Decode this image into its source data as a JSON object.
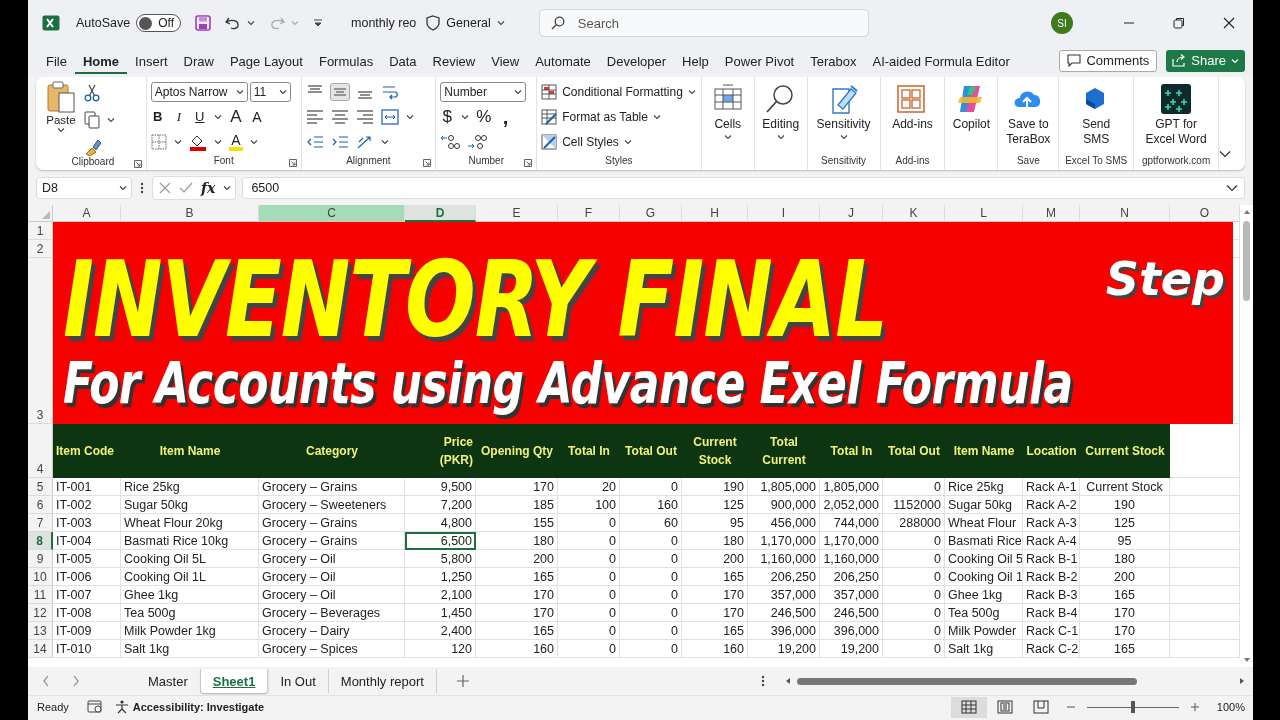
{
  "titlebar": {
    "autosave_label": "AutoSave",
    "autosave": {
      "label": "Off",
      "on": false
    },
    "file_name": "monthly reo",
    "sensitivity_label": "General",
    "search": {
      "placeholder": "Search"
    },
    "avatar": "SI"
  },
  "menu_tabs": [
    {
      "label": "File",
      "selected": false
    },
    {
      "label": "Home",
      "selected": true
    },
    {
      "label": "Insert",
      "selected": false
    },
    {
      "label": "Draw",
      "selected": false
    },
    {
      "label": "Page Layout",
      "selected": false
    },
    {
      "label": "Formulas",
      "selected": false
    },
    {
      "label": "Data",
      "selected": false
    },
    {
      "label": "Review",
      "selected": false
    },
    {
      "label": "View",
      "selected": false
    },
    {
      "label": "Automate",
      "selected": false
    },
    {
      "label": "Developer",
      "selected": false
    },
    {
      "label": "Help",
      "selected": false
    },
    {
      "label": "Power Pivot",
      "selected": false
    },
    {
      "label": "Terabox",
      "selected": false
    },
    {
      "label": "AI-aided Formula Editor",
      "selected": false
    }
  ],
  "actions": {
    "comments": "Comments",
    "share": "Share"
  },
  "ribbon": {
    "clipboard": {
      "paste": "Paste",
      "label": "Clipboard"
    },
    "font": {
      "name": "Aptos Narrow",
      "size": "11",
      "styles": [
        "B",
        "I",
        "U"
      ],
      "size_buttons": [
        "A",
        "A"
      ],
      "color_button": "A",
      "label": "Font"
    },
    "alignment": {
      "label": "Alignment"
    },
    "number": {
      "format": "Number",
      "symbols": [
        "$",
        "%",
        ","
      ],
      "label": "Number"
    },
    "styles": {
      "items": [
        "Conditional Formatting",
        "Format as Table",
        "Cell Styles"
      ],
      "label": "Styles"
    },
    "groups": [
      {
        "buttons": [
          {
            "kind": "cells",
            "label": "Cells",
            "dropdown": true
          }
        ]
      },
      {
        "buttons": [
          {
            "kind": "editing",
            "label": "Editing",
            "dropdown": true
          }
        ]
      },
      {
        "buttons": [
          {
            "kind": "sensitivity",
            "label": "Sensitivity",
            "dropdown": true
          }
        ],
        "label": "Sensitivity"
      },
      {
        "buttons": [
          {
            "kind": "addins",
            "label": "Add-ins",
            "dropdown": false
          }
        ],
        "label": "Add-ins"
      },
      {
        "buttons": [
          {
            "kind": "copilot",
            "label": "Copilot",
            "dropdown": false
          }
        ]
      },
      {
        "buttons": [
          {
            "kind": "terabox",
            "label": "Save to\nTeraBox",
            "dropdown": false
          }
        ],
        "label": "Save"
      },
      {
        "buttons": [
          {
            "kind": "sms",
            "label": "Send\nSMS",
            "dropdown": false
          }
        ],
        "label": "Excel To SMS"
      },
      {
        "buttons": [
          {
            "kind": "gpt",
            "label": "GPT for\nExcel Word",
            "dropdown": false
          }
        ],
        "label": "gptforwork.com"
      }
    ]
  },
  "formula_bar": {
    "cell_ref": "D8",
    "fx": "fx",
    "value": "6500"
  },
  "columns": [
    {
      "letter": "A",
      "selected": false,
      "highlighted": false
    },
    {
      "letter": "B",
      "selected": false,
      "highlighted": false
    },
    {
      "letter": "C",
      "selected": false,
      "highlighted": true
    },
    {
      "letter": "D",
      "selected": true,
      "highlighted": false
    },
    {
      "letter": "E",
      "selected": false,
      "highlighted": false
    },
    {
      "letter": "F",
      "selected": false,
      "highlighted": false
    },
    {
      "letter": "G",
      "selected": false,
      "highlighted": false
    },
    {
      "letter": "H",
      "selected": false,
      "highlighted": false
    },
    {
      "letter": "I",
      "selected": false,
      "highlighted": false
    },
    {
      "letter": "J",
      "selected": false,
      "highlighted": false
    },
    {
      "letter": "K",
      "selected": false,
      "highlighted": false
    },
    {
      "letter": "L",
      "selected": false,
      "highlighted": false
    },
    {
      "letter": "M",
      "selected": false,
      "highlighted": false
    },
    {
      "letter": "N",
      "selected": false,
      "highlighted": false
    },
    {
      "letter": "O",
      "selected": false,
      "highlighted": false
    }
  ],
  "rows": [
    {
      "number": "1",
      "selected": false
    },
    {
      "number": "2",
      "selected": false
    },
    {
      "number": "3",
      "selected": false
    },
    {
      "number": "4",
      "selected": false
    },
    {
      "number": "5",
      "selected": false
    },
    {
      "number": "6",
      "selected": false
    },
    {
      "number": "7",
      "selected": false
    },
    {
      "number": "8",
      "selected": true
    },
    {
      "number": "9",
      "selected": false
    },
    {
      "number": "10",
      "selected": false
    },
    {
      "number": "11",
      "selected": false
    },
    {
      "number": "12",
      "selected": false
    },
    {
      "number": "13",
      "selected": false
    },
    {
      "number": "14",
      "selected": false
    }
  ],
  "banner": {
    "title": "INVENTORY FINAL",
    "tag": "Step",
    "subtitle": "For Accounts using Advance Exel Formula"
  },
  "table": {
    "headers": [
      "Item Code",
      "Item Name",
      "Category",
      "Price (PKR)",
      "Opening Qty",
      "Total In",
      "Total Out",
      "Current\nStock",
      "Total\nCurrent",
      "Total In",
      "Total Out",
      "Item Name",
      "Location",
      "Current Stock"
    ],
    "rows": [
      [
        "IT-001",
        "Rice 25kg",
        "Grocery – Grains",
        "9,500",
        "170",
        "20",
        "0",
        "190",
        "1,805,000",
        "1,805,000",
        "0",
        "Rice 25kg",
        "Rack A-1",
        "Current Stock"
      ],
      [
        "IT-002",
        "Sugar 50kg",
        "Grocery – Sweeteners",
        "7,200",
        "185",
        "100",
        "160",
        "125",
        "900,000",
        "2,052,000",
        "1152000",
        "Sugar 50kg",
        "Rack A-2",
        "190"
      ],
      [
        "IT-003",
        "Wheat Flour 20kg",
        "Grocery – Grains",
        "4,800",
        "155",
        "0",
        "60",
        "95",
        "456,000",
        "744,000",
        "288000",
        "Wheat Flour",
        "Rack A-3",
        "125"
      ],
      [
        "IT-004",
        "Basmati Rice 10kg",
        "Grocery – Grains",
        "6,500",
        "180",
        "0",
        "0",
        "180",
        "1,170,000",
        "1,170,000",
        "0",
        "Basmati Rice",
        "Rack A-4",
        "95"
      ],
      [
        "IT-005",
        "Cooking Oil 5L",
        "Grocery – Oil",
        "5,800",
        "200",
        "0",
        "0",
        "200",
        "1,160,000",
        "1,160,000",
        "0",
        "Cooking Oil 5",
        "Rack B-1",
        "180"
      ],
      [
        "IT-006",
        "Cooking Oil 1L",
        "Grocery – Oil",
        "1,250",
        "165",
        "0",
        "0",
        "165",
        "206,250",
        "206,250",
        "0",
        "Cooking Oil 1",
        "Rack B-2",
        "200"
      ],
      [
        "IT-007",
        "Ghee 1kg",
        "Grocery – Oil",
        "2,100",
        "170",
        "0",
        "0",
        "170",
        "357,000",
        "357,000",
        "0",
        "Ghee 1kg",
        "Rack B-3",
        "165"
      ],
      [
        "IT-008",
        "Tea 500g",
        "Grocery – Beverages",
        "1,450",
        "170",
        "0",
        "0",
        "170",
        "246,500",
        "246,500",
        "0",
        "Tea 500g",
        "Rack B-4",
        "170"
      ],
      [
        "IT-009",
        "Milk Powder 1kg",
        "Grocery – Dairy",
        "2,400",
        "165",
        "0",
        "0",
        "165",
        "396,000",
        "396,000",
        "0",
        "Milk Powder",
        "Rack C-1",
        "170"
      ],
      [
        "IT-010",
        "Salt 1kg",
        "Grocery – Spices",
        "120",
        "160",
        "0",
        "0",
        "160",
        "19,200",
        "19,200",
        "0",
        "Salt 1kg",
        "Rack C-2",
        "165"
      ]
    ]
  },
  "sheet_tabs": [
    {
      "label": "Master",
      "selected": false
    },
    {
      "label": "Sheet1",
      "selected": true
    },
    {
      "label": "In Out",
      "selected": false
    },
    {
      "label": "Monthly report",
      "selected": false
    }
  ],
  "status_bar": {
    "ready": "Ready",
    "accessibility": "Accessibility: Investigate",
    "views": [
      {
        "kind": "normal",
        "selected": true
      },
      {
        "kind": "page_layout",
        "selected": false
      },
      {
        "kind": "page_break",
        "selected": false
      }
    ],
    "zoom": {
      "level": 0.5,
      "reading": "100%"
    }
  }
}
